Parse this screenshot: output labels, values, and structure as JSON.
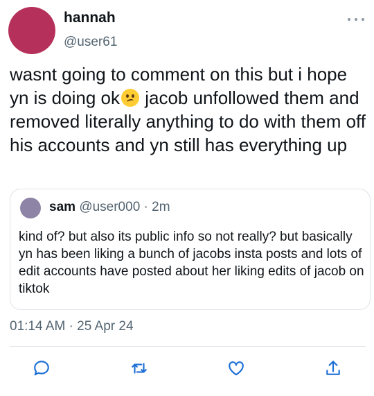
{
  "author": {
    "display_name": "hannah",
    "handle": "@user61"
  },
  "tweet": {
    "text_before_emoji": "wasnt going to comment on this but i hope yn is doing ok",
    "emoji": "confused-face",
    "text_after_emoji": " jacob unfollowed them and removed literally anything to do with them off his accounts and yn still has everything up",
    "timestamp": "01:14 AM · 25 Apr 24"
  },
  "quoted_tweet": {
    "display_name": "sam",
    "meta": "@user000 · 2m",
    "text": "kind of? but also its public info so not really? but basically yn has been liking a bunch of jacobs insta posts and lots of edit accounts have posted about her liking edits of jacob on tiktok"
  },
  "colors": {
    "author_avatar": "#b5305a",
    "quoted_avatar": "#8d84a6",
    "action_icon": "#1d6fd6",
    "muted_text": "#536471"
  },
  "actions": [
    "reply-icon",
    "retweet-icon",
    "like-icon",
    "share-icon"
  ]
}
